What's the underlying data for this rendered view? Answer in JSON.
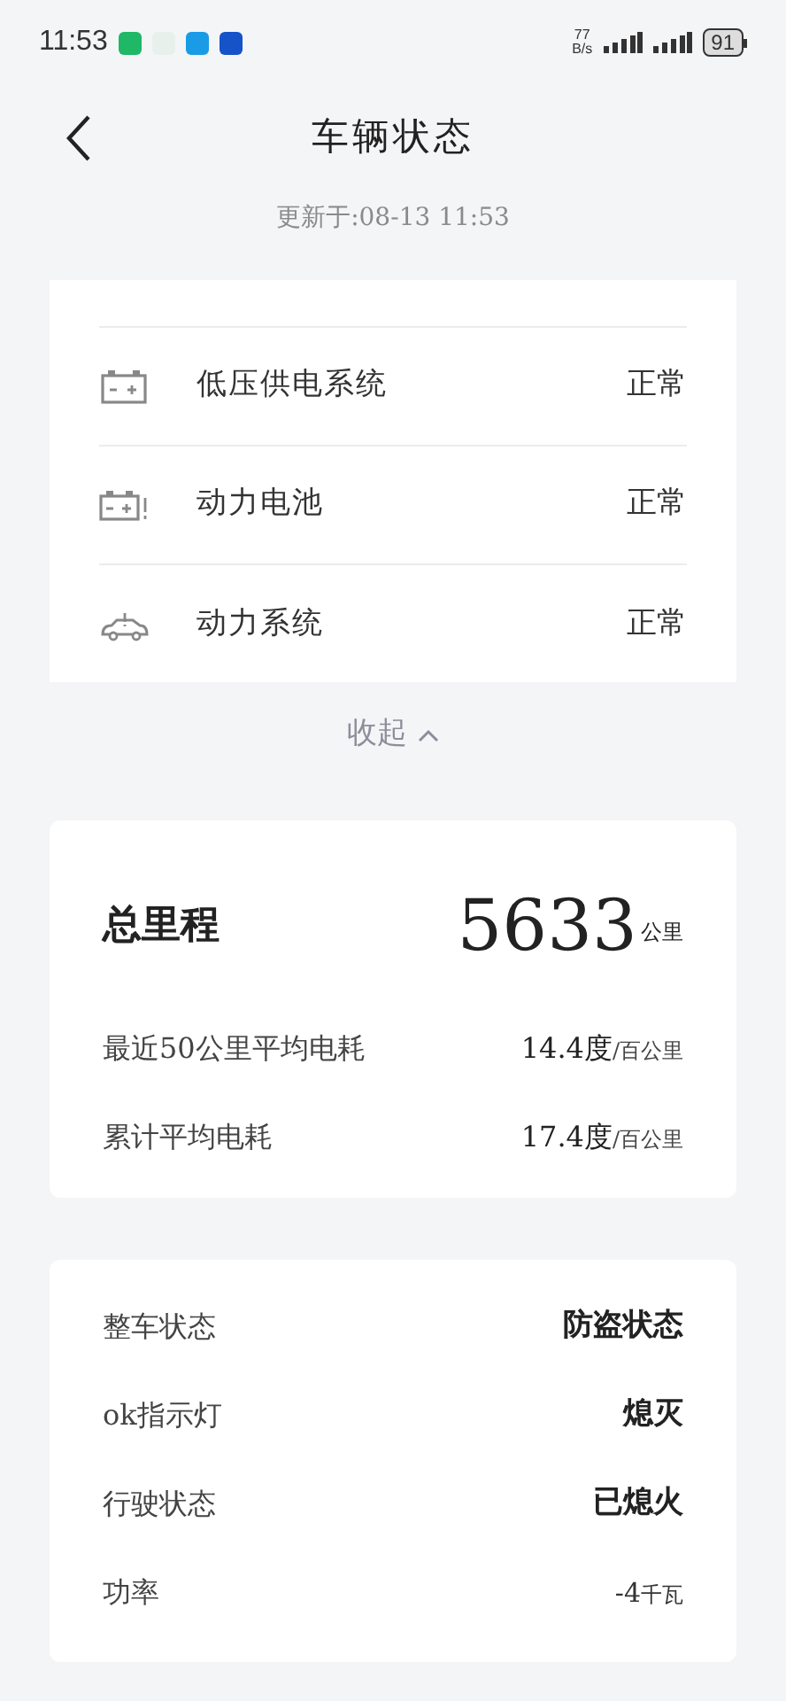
{
  "status_bar": {
    "time": "11:53",
    "net_speed": "77",
    "net_unit": "B/s",
    "battery": "91",
    "notification_icons": [
      {
        "color": "#1fb866"
      },
      {
        "color": "#e8f0ec"
      },
      {
        "color": "#1a9be6"
      },
      {
        "color": "#1652c8"
      }
    ]
  },
  "header": {
    "title": "车辆状态",
    "updated": "更新于:08-13 11:53"
  },
  "systems": [
    {
      "kind": "battery",
      "name": "低压供电系统",
      "status": "正常"
    },
    {
      "kind": "battery-alert",
      "name": "动力电池",
      "status": "正常"
    },
    {
      "kind": "car",
      "name": "动力系统",
      "status": "正常"
    }
  ],
  "collapse": {
    "label": "收起",
    "expanded": true
  },
  "mileage": {
    "label": "总里程",
    "value": "5633",
    "unit": "公里",
    "rows": [
      {
        "label": "最近50公里平均电耗",
        "value": "14.4度",
        "unit": "/百公里"
      },
      {
        "label": "累计平均电耗",
        "value": "17.4度",
        "unit": "/百公里"
      }
    ]
  },
  "vehicle": [
    {
      "label": "整车状态",
      "value": "防盗状态"
    },
    {
      "label": "ok指示灯",
      "value": "熄灭"
    },
    {
      "label": "行驶状态",
      "value": "已熄火"
    },
    {
      "label": "功率",
      "value": "-4",
      "unit": "千瓦"
    }
  ]
}
